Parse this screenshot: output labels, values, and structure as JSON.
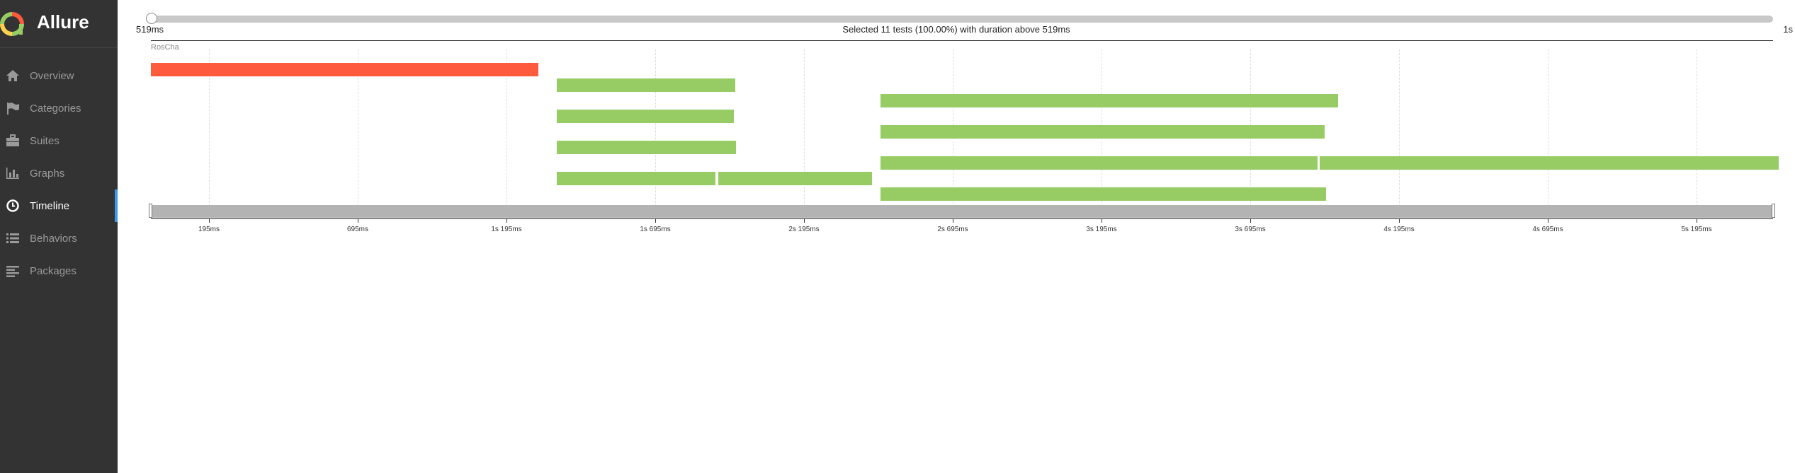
{
  "sidebar": {
    "brand": "Allure",
    "items": [
      {
        "label": "Overview",
        "icon": "home-icon"
      },
      {
        "label": "Categories",
        "icon": "flag-icon"
      },
      {
        "label": "Suites",
        "icon": "briefcase-icon"
      },
      {
        "label": "Graphs",
        "icon": "bar-chart-icon"
      },
      {
        "label": "Timeline",
        "icon": "clock-icon",
        "active": true
      },
      {
        "label": "Behaviors",
        "icon": "list-icon"
      },
      {
        "label": "Packages",
        "icon": "align-left-icon"
      }
    ]
  },
  "slider": {
    "min_label": "519ms",
    "max_label": "1s",
    "selected_text": "Selected 11 tests (100.00%) with duration above 519ms"
  },
  "timeline": {
    "host": "RosCha",
    "ticks": [
      "195ms",
      "695ms",
      "1s 195ms",
      "1s 695ms",
      "2s 195ms",
      "2s 695ms",
      "3s 195ms",
      "3s 695ms",
      "4s 195ms",
      "4s 695ms",
      "5s 195ms"
    ],
    "colors": {
      "failed": "#fd5a3e",
      "passed": "#97cc64"
    }
  }
}
